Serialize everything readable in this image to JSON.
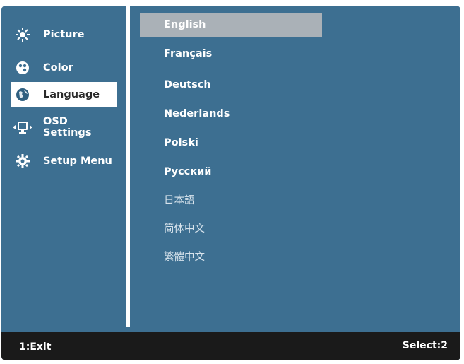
{
  "sidebar": {
    "items": [
      {
        "label": "Picture",
        "icon": "brightness-icon"
      },
      {
        "label": "Color",
        "icon": "color-palette-icon"
      },
      {
        "label": "Language",
        "icon": "globe-icon",
        "selected": true
      },
      {
        "label": "OSD Settings",
        "icon": "osd-settings-icon"
      },
      {
        "label": "Setup Menu",
        "icon": "gear-icon"
      }
    ]
  },
  "languages": {
    "selected": "English",
    "items": [
      "English",
      "Français",
      "Deutsch",
      "Nederlands",
      "Polski",
      "Русский",
      "日本語",
      "简体中文",
      "繁體中文"
    ]
  },
  "footer": {
    "exit_label": "1:Exit",
    "select_label": "Select:2"
  },
  "colors": {
    "panel": "#3d6f91",
    "highlight": "#aab1b7",
    "footer": "#1a1a1a"
  }
}
